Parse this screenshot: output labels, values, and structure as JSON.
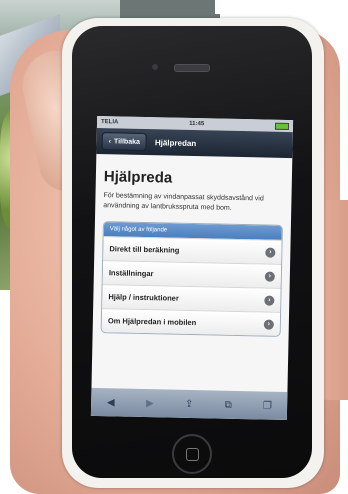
{
  "status_bar": {
    "carrier": "TELIA",
    "time": "11:45"
  },
  "nav": {
    "back_label": "Tillbaka",
    "title": "Hjälpredan"
  },
  "page": {
    "title": "Hjälpreda",
    "intro": "För bestämning av vindanpassat skyddsavstånd vid användning av lantbruksspruta med bom."
  },
  "menu": {
    "header": "Välj något av följande",
    "items": [
      {
        "label": "Direkt till beräkning"
      },
      {
        "label": "Inställningar"
      },
      {
        "label": "Hjälp / instruktioner"
      },
      {
        "label": "Om Hjälpredan i mobilen"
      }
    ]
  },
  "toolbar": {
    "icons": [
      "back-arrow-icon",
      "forward-arrow-icon",
      "share-icon",
      "bookmarks-icon",
      "tabs-icon"
    ]
  },
  "colors": {
    "nav_bar": "#2a3545",
    "menu_header": "#4a7fc0",
    "toolbar": "#8e9db1"
  }
}
